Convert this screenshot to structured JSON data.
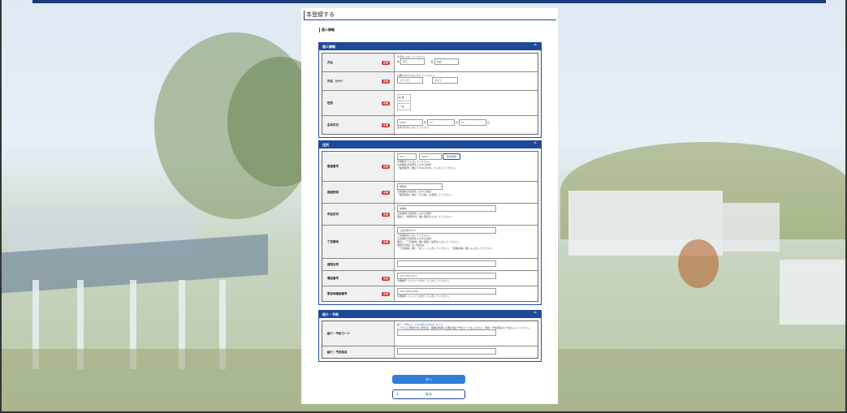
{
  "page": {
    "title": "本登録する",
    "subheading": "個人情報"
  },
  "sections": {
    "personal": {
      "header": "個人情報",
      "required_badge": "必須",
      "name": {
        "label": "氏名",
        "note": "氏名を入力してください。",
        "sei_label": "姓",
        "sei_value": "東工",
        "mei_label": "名",
        "mei_value": "太郎"
      },
      "kana": {
        "label": "氏名（カナ）",
        "note": "全角カタカナを入力してください。",
        "sei_value": "トウコウ",
        "mei_value": "タロウ"
      },
      "gender": {
        "label": "性別",
        "options": [
          "男",
          "女"
        ],
        "selected": "男"
      },
      "birthday": {
        "label": "生年月日",
        "year_value": "2000",
        "year_unit": "年",
        "month_value": "12",
        "month_unit": "月",
        "day_value": "31",
        "day_unit": "日",
        "note": "生年月日を入力してください。"
      }
    },
    "address": {
      "header": "住所",
      "postal": {
        "label": "郵便番号",
        "part1": "371",
        "sep": "-",
        "part2": "0816",
        "search_button": "住所検索",
        "notes": [
          "半角数字で入力してください。",
          "日本国外の住所を入力する場合",
          "「郵便番号」欄は「000-0000」と入力してください。"
        ]
      },
      "prefecture": {
        "label": "都道府県",
        "value": "群馬県",
        "notes": [
          "日本国外の住所を入力する場合",
          "「都道府県」欄は「その他」を選択してください。"
        ]
      },
      "city": {
        "label": "市区町村",
        "value": "前橋市",
        "notes": [
          "日本国外の住所を入力する場合",
          "国名と「市区町村」欄に国名を入力してください。"
        ]
      },
      "street": {
        "label": "丁目番地",
        "value": "上佐鳥町460-1",
        "notes": [
          "丁目番地を入力してください。",
          "日本国外の住所を入力する場合",
          "国名と「丁目番地」欄に国名と住所を入力してください。",
          "番地が存在しない場合は、",
          "「丁目番地」欄に「なし」と入力してください。「建物名等」欄にも入力してください。"
        ]
      },
      "building": {
        "label": "建物名等",
        "value": ""
      },
      "phone": {
        "label": "電話番号",
        "value": "027-265-0111",
        "note": "半角数字（ハイフン付き）で入力してください。"
      },
      "emergency": {
        "label": "緊急時連絡番号",
        "value": "090-0000-0000",
        "note": "半角数字（ハイフン付き）で入力してください。"
      }
    },
    "promo": {
      "header": "紹介・予約",
      "code": {
        "label": "紹介・予約コード",
        "link": "紹介・予約コードをお持ちの方はこちらへ",
        "note": "システムに登録がない場合は、各種資料等に記載の紹介予約コードを入力の上、登録・予約者名などを記入してください。",
        "value": ""
      },
      "person": {
        "label": "紹介・予約者名",
        "value": ""
      }
    }
  },
  "buttons": {
    "next": "次へ",
    "back": "戻る"
  },
  "colors": {
    "header_blue": "#1d4b99",
    "required_red": "#d32f2f",
    "next_button": "#2f7fd9"
  }
}
